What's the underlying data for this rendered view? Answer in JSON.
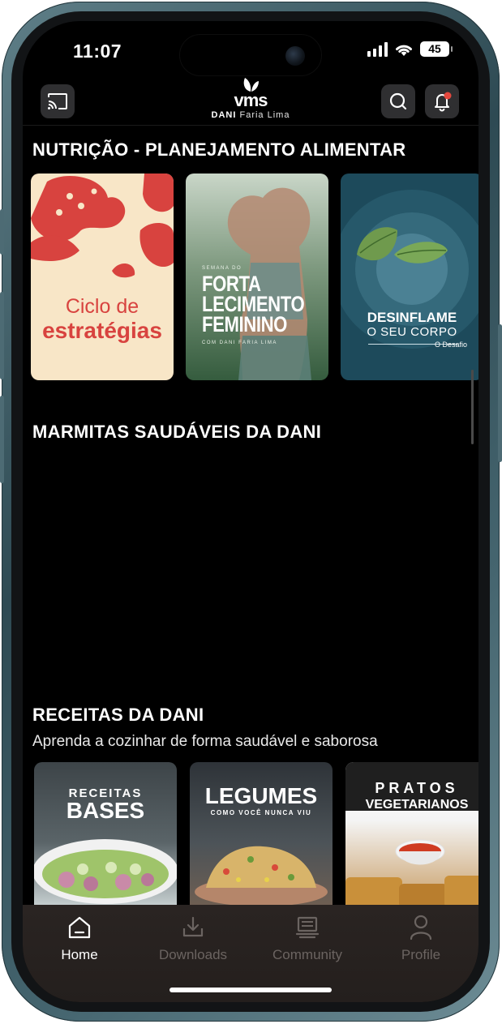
{
  "status_bar": {
    "time": "11:07",
    "battery": "45",
    "icons": [
      "signal-icon",
      "wifi-icon",
      "battery-icon"
    ]
  },
  "header": {
    "logo_text": "vms",
    "logo_sub_bold": "DANI",
    "logo_sub_rest": "Faria Lima",
    "left_icon": "cast-icon",
    "right_icons": [
      "search-icon",
      "bell-icon"
    ]
  },
  "sections": {
    "nutricao": {
      "title": "NUTRIÇÃO - PLANEJAMENTO ALIMENTAR",
      "cards": [
        {
          "line1": "Ciclo de",
          "line2": "estratégias"
        },
        {
          "small": "SEMANA DO",
          "big": [
            "FORTA",
            "LECIMENTO",
            "FEMININO"
          ],
          "credit": "COM DANI FARIA LIMA"
        },
        {
          "line1": "DESINFLAME",
          "line2": "O SEU CORPO",
          "line3": "O Desafio"
        }
      ]
    },
    "marmitas": {
      "title": "MARMITAS SAUDÁVEIS DA DANI"
    },
    "receitas": {
      "title": "RECEITAS DA DANI",
      "subtitle": "Aprenda a cozinhar de forma saudável e saborosa",
      "cards": [
        {
          "line1": "RECEITAS",
          "line2": "BASES"
        },
        {
          "line1": "LEGUMES",
          "line2": "COMO VOCÊ NUNCA VIU"
        },
        {
          "line1": "PRATOS",
          "line2": "VEGETARIANOS"
        }
      ]
    }
  },
  "tabs": [
    {
      "label": "Home",
      "icon": "home-icon",
      "active": true
    },
    {
      "label": "Downloads",
      "icon": "download-icon",
      "active": false
    },
    {
      "label": "Community",
      "icon": "community-icon",
      "active": false
    },
    {
      "label": "Profile",
      "icon": "profile-icon",
      "active": false
    }
  ],
  "colors": {
    "active_tab": "#ffffff",
    "inactive_tab": "#6b6461",
    "notification_dot": "#e5483e",
    "card_red": "#d8433f"
  }
}
